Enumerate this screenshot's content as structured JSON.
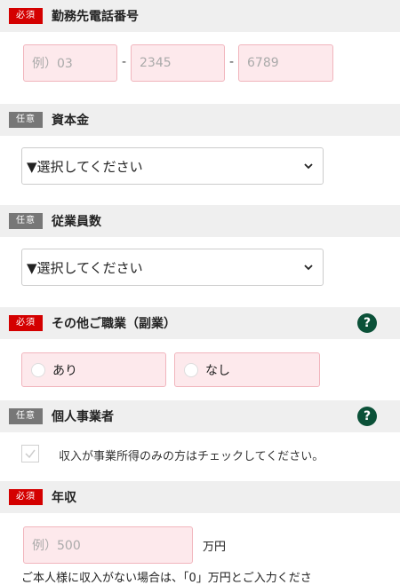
{
  "phone": {
    "badge": "必須",
    "title": "勤務先電話番号",
    "field1_placeholder": "例）03",
    "field2_placeholder": "2345",
    "field3_placeholder": "6789",
    "separator": "-"
  },
  "capital": {
    "badge": "任意",
    "title": "資本金",
    "select_value": "▼選択してください"
  },
  "employees": {
    "badge": "任意",
    "title": "従業員数",
    "select_value": "▼選択してください"
  },
  "side_job": {
    "badge": "必須",
    "title": "その他ご職業（副業）",
    "help": "?",
    "options": [
      "あり",
      "なし"
    ]
  },
  "sole_proprietor": {
    "badge": "任意",
    "title": "個人事業者",
    "help": "?",
    "checkbox_label": "収入が事業所得のみの方はチェックしてください。"
  },
  "income": {
    "badge": "必須",
    "title": "年収",
    "placeholder": "例）500",
    "unit": "万円",
    "note": "ご本人様に収入がない場合は、「0」万円とご入力くださ"
  },
  "colors": {
    "required_badge": "#d40000",
    "optional_badge": "#777777",
    "input_bg": "#fde9ec",
    "help_icon": "#0b5138"
  }
}
